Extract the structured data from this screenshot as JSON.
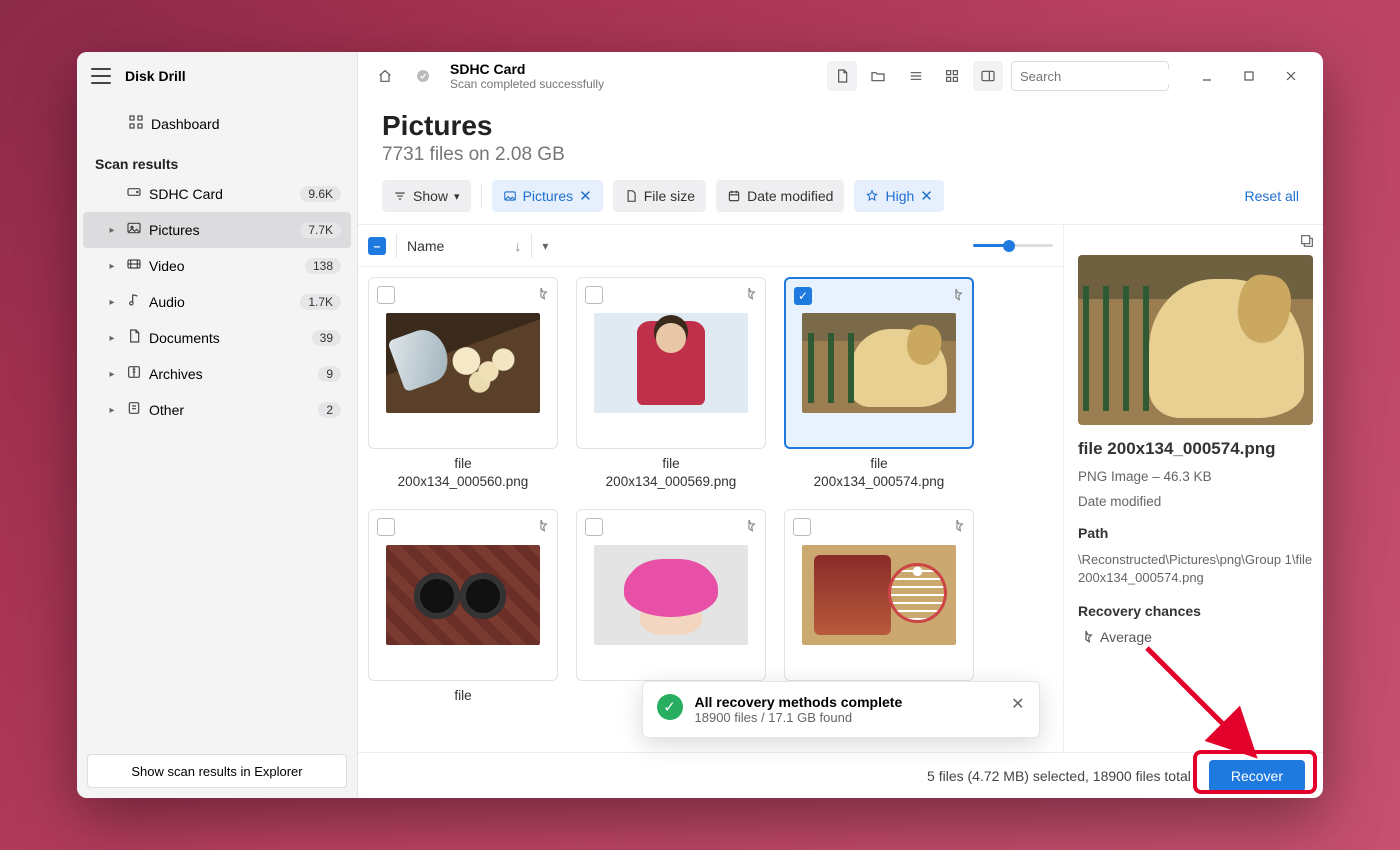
{
  "app": {
    "title": "Disk Drill"
  },
  "sidebar": {
    "dashboard_label": "Dashboard",
    "scan_results_heading": "Scan results",
    "items": [
      {
        "label": "SDHC Card",
        "badge": "9.6K",
        "icon": "drive"
      },
      {
        "label": "Pictures",
        "badge": "7.7K",
        "icon": "image",
        "selected": true
      },
      {
        "label": "Video",
        "badge": "138",
        "icon": "video"
      },
      {
        "label": "Audio",
        "badge": "1.7K",
        "icon": "audio"
      },
      {
        "label": "Documents",
        "badge": "39",
        "icon": "doc"
      },
      {
        "label": "Archives",
        "badge": "9",
        "icon": "archive"
      },
      {
        "label": "Other",
        "badge": "2",
        "icon": "other"
      }
    ],
    "footer_button": "Show scan results in Explorer"
  },
  "topbar": {
    "breadcrumb_title": "SDHC Card",
    "breadcrumb_sub": "Scan completed successfully",
    "search_placeholder": "Search"
  },
  "page": {
    "title": "Pictures",
    "subtitle": "7731 files on 2.08 GB"
  },
  "filters": {
    "show_label": "Show",
    "chips": [
      {
        "label": "Pictures",
        "style": "blue",
        "icon": "image",
        "close": true
      },
      {
        "label": "File size",
        "style": "gray",
        "icon": "doc"
      },
      {
        "label": "Date modified",
        "style": "gray",
        "icon": "calendar"
      },
      {
        "label": "High",
        "style": "blue",
        "icon": "star",
        "close": true
      }
    ],
    "reset_label": "Reset all"
  },
  "columns": {
    "name_label": "Name"
  },
  "files": [
    {
      "name1": "file",
      "name2": "200x134_000560.png",
      "thumb": "popcorn"
    },
    {
      "name1": "file",
      "name2": "200x134_000569.png",
      "thumb": "man"
    },
    {
      "name1": "file",
      "name2": "200x134_000574.png",
      "thumb": "dog",
      "selected": true
    },
    {
      "name1": "file",
      "name2": "",
      "thumb": "binoc"
    },
    {
      "name1": "file",
      "name2": "",
      "thumb": "hat"
    },
    {
      "name1": "file",
      "name2": "",
      "thumb": "bball"
    }
  ],
  "detail": {
    "filename": "file 200x134_000574.png",
    "meta": "PNG Image – 46.3 KB",
    "date_label": "Date modified",
    "path_label": "Path",
    "path_value": "\\Reconstructed\\Pictures\\png\\Group 1\\file 200x134_000574.png",
    "chances_label": "Recovery chances",
    "chances_value": "Average"
  },
  "toast": {
    "title": "All recovery methods complete",
    "subtitle": "18900 files / 17.1 GB found"
  },
  "footer": {
    "status": "5 files (4.72 MB) selected, 18900 files total",
    "recover_label": "Recover"
  }
}
